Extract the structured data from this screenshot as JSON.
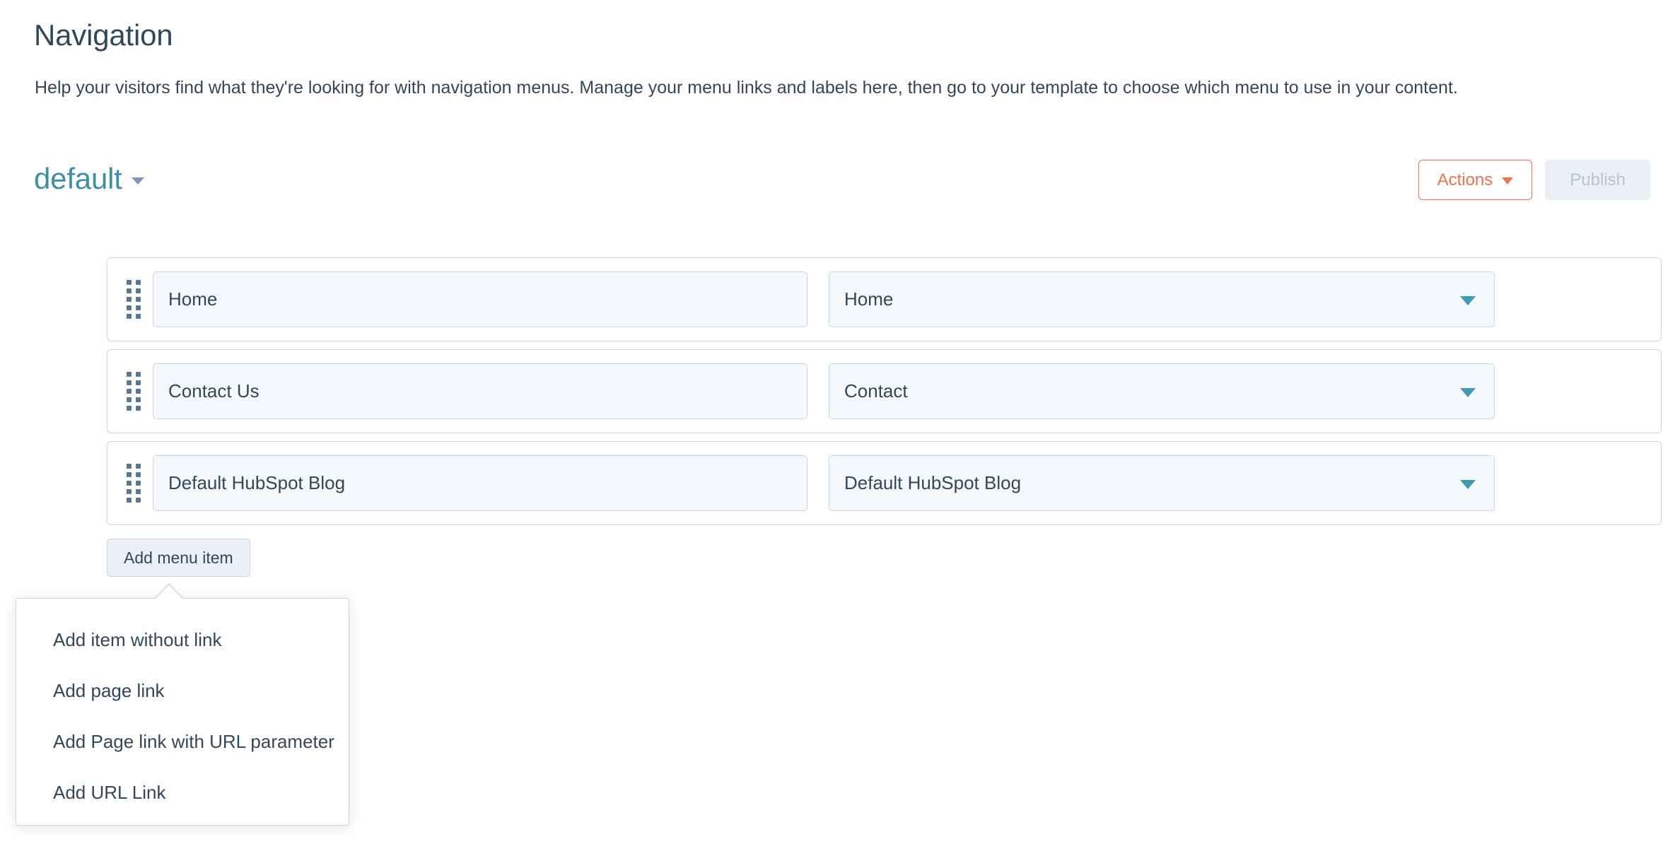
{
  "header": {
    "title": "Navigation",
    "description": "Help your visitors find what they're looking for with navigation menus. Manage your menu links and labels here, then go to your template to choose which menu to use in your content."
  },
  "menu_selector": {
    "selected_menu": "default",
    "caret_icon": "chevron-down-icon"
  },
  "toolbar": {
    "actions_label": "Actions",
    "actions_caret_icon": "caret-down-icon",
    "publish_label": "Publish",
    "publish_disabled": true
  },
  "menu_rows": [
    {
      "drag_handle_icon": "drag-dots-icon",
      "label_value": "Home",
      "label_placeholder": "Label",
      "link_value": "Home",
      "link_caret_icon": "caret-down-icon"
    },
    {
      "drag_handle_icon": "drag-dots-icon",
      "label_value": "Contact Us",
      "label_placeholder": "Label",
      "link_value": "Contact",
      "link_caret_icon": "caret-down-icon"
    },
    {
      "drag_handle_icon": "drag-dots-icon",
      "label_value": "Default HubSpot Blog",
      "label_placeholder": "Label",
      "link_value": "Default HubSpot Blog",
      "link_caret_icon": "caret-down-icon"
    }
  ],
  "add_menu_item": {
    "button_label": "Add menu item",
    "popover_open": true,
    "options": [
      {
        "label": "Add item without link"
      },
      {
        "label": "Add page link"
      },
      {
        "label": "Add Page link with URL parameter"
      },
      {
        "label": "Add URL Link"
      }
    ]
  },
  "colors": {
    "text_primary": "#33475b",
    "accent_teal": "#3f8fa4",
    "accent_orange": "#ec7253",
    "border": "#cbd6e2",
    "field_bg": "#f5f8fa",
    "button_bg": "#eaf0f6",
    "disabled_text": "#b9c4ce",
    "select_caret": "#3f9bb5"
  }
}
